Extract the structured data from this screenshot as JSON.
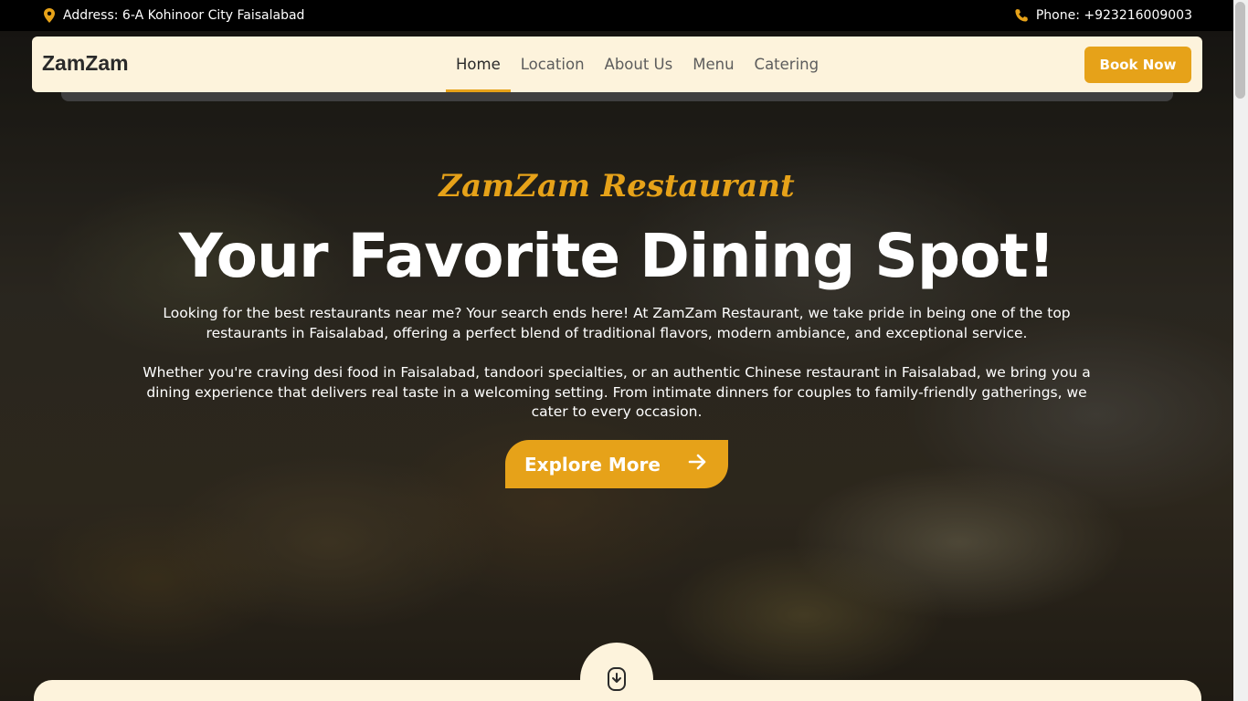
{
  "topbar": {
    "address": "Address: 6-A Kohinoor City Faisalabad",
    "phone": "Phone: +923216009003",
    "address_icon": "location-pin-icon",
    "phone_icon": "phone-icon"
  },
  "navbar": {
    "brand": "ZamZam",
    "items": [
      {
        "label": "Home",
        "active": true
      },
      {
        "label": "Location",
        "active": false
      },
      {
        "label": "About Us",
        "active": false
      },
      {
        "label": "Menu",
        "active": false
      },
      {
        "label": "Catering",
        "active": false
      }
    ],
    "book_label": "Book Now"
  },
  "hero": {
    "script_title": "ZamZam Restaurant",
    "title": "Your Favorite Dining Spot!",
    "paragraph1": "Looking for the best restaurants near me? Your search ends here! At ZamZam Restaurant, we take pride in being one of the top restaurants in Faisalabad, offering a perfect blend of traditional flavors, modern ambiance, and exceptional service.",
    "paragraph2": "Whether you're craving desi food in Faisalabad, tandoori specialties, or an authentic Chinese restaurant in Faisalabad, we bring you a dining experience that delivers real taste in a welcoming setting. From intimate dinners for couples to family-friendly gatherings, we cater to every occasion.",
    "explore_label": "Explore More",
    "explore_icon": "arrow-right-icon",
    "scroll_icon": "scroll-down-icon"
  },
  "colors": {
    "accent": "#e6a219",
    "cream": "#fdf3dc",
    "dark": "#2a2a2a"
  }
}
